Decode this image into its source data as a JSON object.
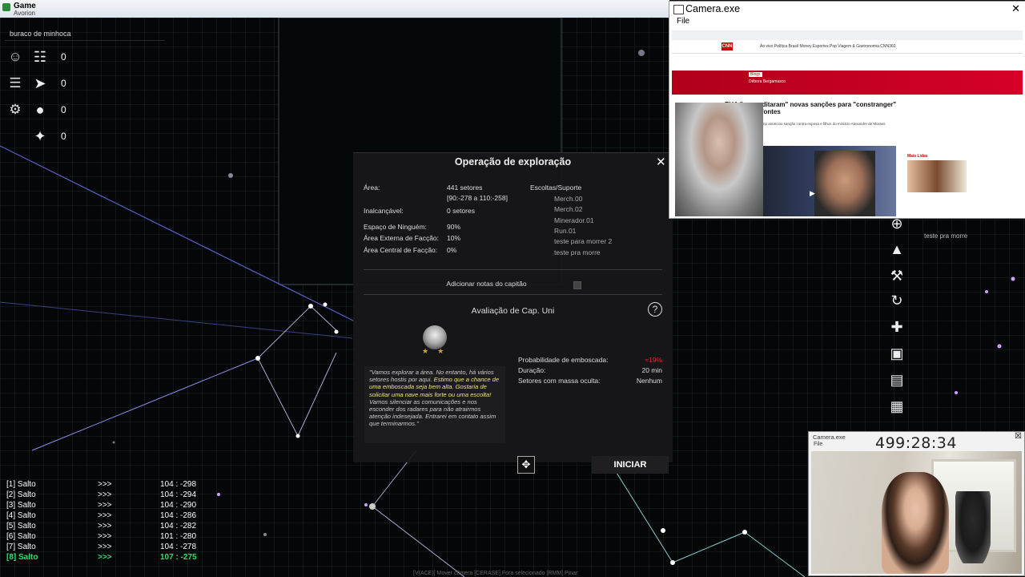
{
  "window": {
    "title": "Game",
    "subtitle": "Avorion"
  },
  "hud": {
    "sector_name": "buraco de minhoca",
    "counters": [
      {
        "icon": "captain-icon",
        "icon2": "station-icon",
        "value": "0"
      },
      {
        "icon": "list-icon",
        "icon2": "rocket-icon",
        "value": "0"
      },
      {
        "icon": "gear-icon",
        "icon2": "ore-icon",
        "value": "0"
      },
      {
        "icon": "",
        "icon2": "fighter-icon",
        "value": "0"
      }
    ]
  },
  "dialog": {
    "title": "Operação de exploração",
    "labels": {
      "area": "Área:",
      "unreachable": "Inalcançável:",
      "no_mans": "Espaço de Ninguém:",
      "outer": "Área Externa de Facção:",
      "central": "Área Central de Facção:",
      "escorts_header": "Escoltas/Suporte"
    },
    "values": {
      "area": "441 setores",
      "area_range": "[90:-278 a 110:-258]",
      "unreachable": "0 setores",
      "no_mans": "90%",
      "outer": "10%",
      "central": "0%"
    },
    "escorts": [
      "Merch.00",
      "Merch.02",
      "Minerador.01",
      "Run.01",
      "teste para morrer 2",
      "teste pra morre"
    ],
    "notes_label": "Adicionar notas do capitão",
    "rating_title": "Avaliação de Cap. Uni",
    "quote_part1": "\"Vamos explorar a área. No entanto, há vários setores hostis por aqui.",
    "quote_highlight": "Estimo que a chance de uma emboscada seja bem alta. Gostaria de solicitar uma nave mais forte ou uma escolta!",
    "quote_part2": "Vamos silenciar as comunicações e nos esconder dos radares para não atrairmos atenção indesejada. Entrarei em contato assim que terminarmos.\"",
    "stats": [
      {
        "label": "Probabilidade de emboscada:",
        "value": "≈19%"
      },
      {
        "label": "Duração:",
        "value": "20 min"
      },
      {
        "label": "Setores com massa oculta:",
        "value": "Nenhum"
      }
    ],
    "start_label": "INICIAR",
    "close_symbol": "✕"
  },
  "jumps": [
    {
      "label": "[1] Salto",
      "arrow": ">>>",
      "coords": "104 : -298",
      "active": false
    },
    {
      "label": "[2] Salto",
      "arrow": ">>>",
      "coords": "104 : -294",
      "active": false
    },
    {
      "label": "[3] Salto",
      "arrow": ">>>",
      "coords": "104 : -290",
      "active": false
    },
    {
      "label": "[4] Salto",
      "arrow": ">>>",
      "coords": "104 : -286",
      "active": false
    },
    {
      "label": "[5] Salto",
      "arrow": ">>>",
      "coords": "104 : -282",
      "active": false
    },
    {
      "label": "[6] Salto",
      "arrow": ">>>",
      "coords": "101 : -280",
      "active": false
    },
    {
      "label": "[7] Salto",
      "arrow": ">>>",
      "coords": "104 : -278",
      "active": false
    },
    {
      "label": "[8] Salto",
      "arrow": ">>>",
      "coords": "107 : -275",
      "active": true
    }
  ],
  "right_toolbar": {
    "label": "teste pra morre"
  },
  "bottom_status": "[V(ACE)] Mover câmera   [CERASE] Fora selecionado   [RMM] Pinar",
  "camera1": {
    "title": "Camera.exe",
    "menu": "File",
    "site_logo": "CNN",
    "nav": "Ao vivo   Política   Brasil   Money   Esportes   Pop   Viagem & Gastronomia   CNN360",
    "red_tag": "Blogs",
    "red_text": "Débora Bergamasco",
    "headline": "EUA \"premeditaram\" novas sanções para \"constranger\" Lula, dizem fontes",
    "subtext": "Governo de Donald Trump anunciou sanção contra esposa e filhos do ministro Alexandre de Moraes",
    "side_header": "Mais Lidas"
  },
  "camera2": {
    "title": "Camera.exe",
    "menu": "File",
    "clock": "499:28:34"
  }
}
